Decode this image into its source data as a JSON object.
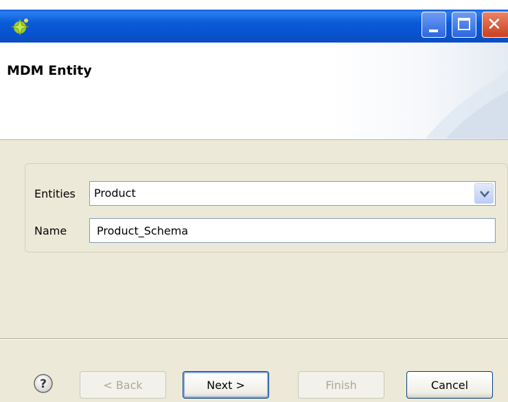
{
  "window": {
    "title_icon": "wizard-sparkle-icon",
    "controls": {
      "minimize": "minimize-icon",
      "maximize": "maximize-icon",
      "close": "close-icon"
    }
  },
  "banner": {
    "title": "MDM Entity"
  },
  "form": {
    "entities_label": "Entities",
    "entities_value": "Product",
    "name_label": "Name",
    "name_value": "Product_Schema"
  },
  "footer": {
    "help_icon": "help-icon",
    "back_label": "< Back",
    "next_label": "Next >",
    "finish_label": "Finish",
    "cancel_label": "Cancel"
  },
  "colors": {
    "titlebar": "#0b5bd8",
    "dialog_bg": "#ece9d8",
    "input_border": "#7f9db9",
    "disabled_text": "#aca899"
  }
}
